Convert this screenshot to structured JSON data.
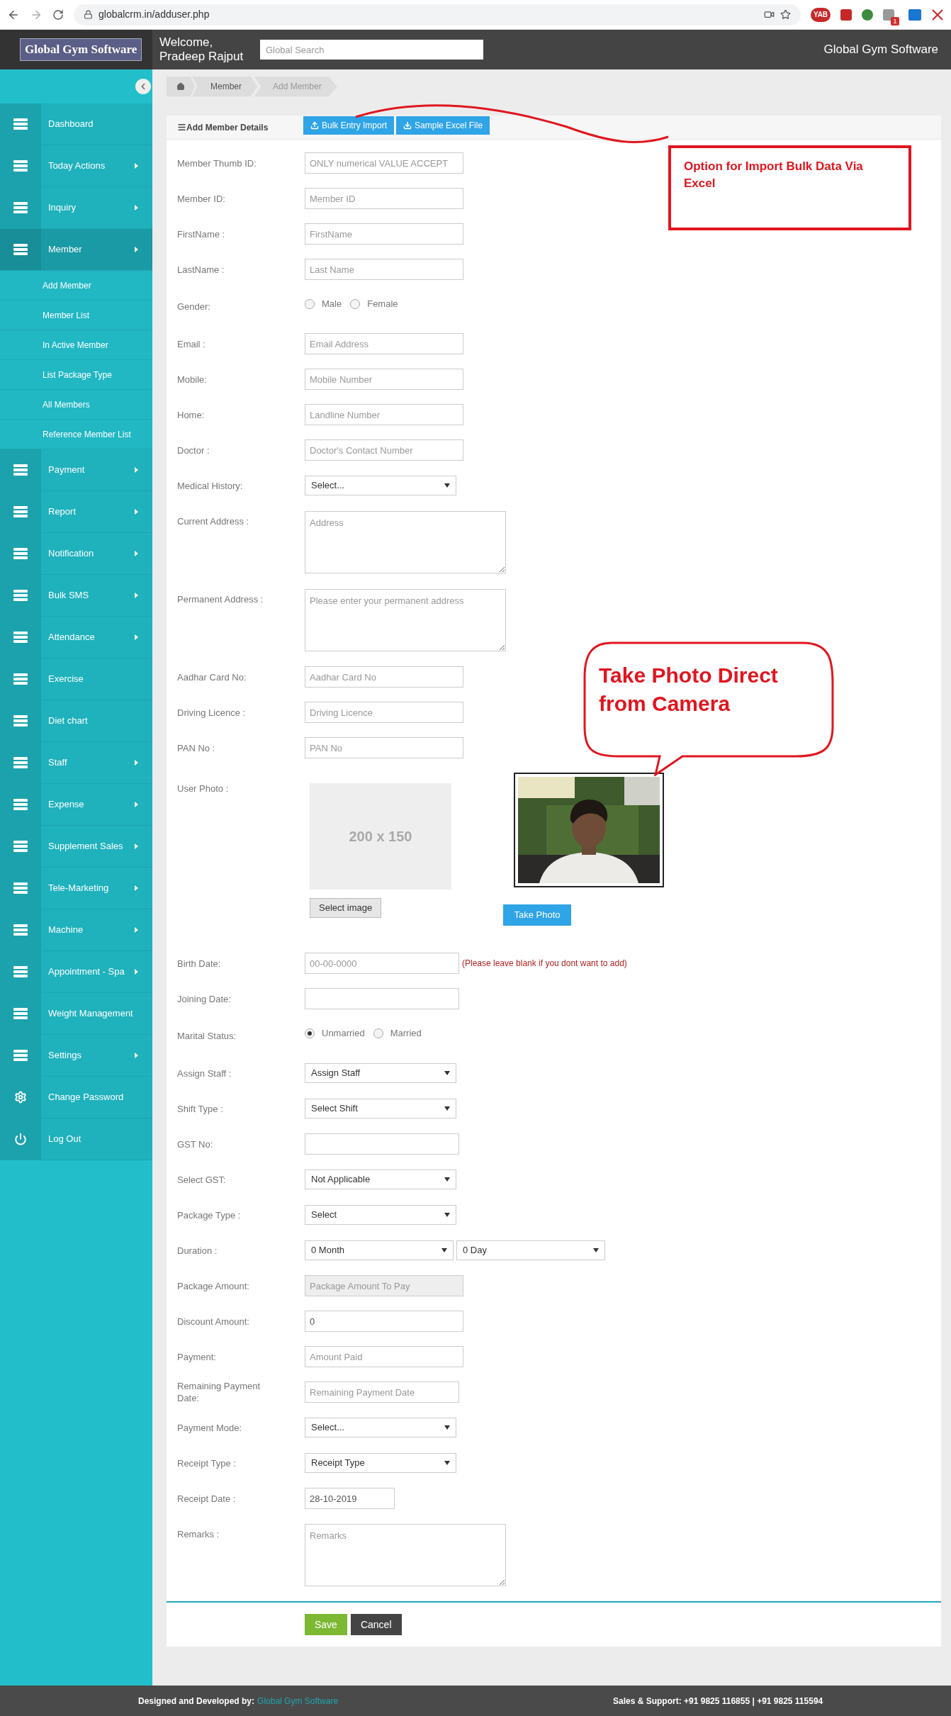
{
  "browser": {
    "url": "globalcrm.in/adduser.php",
    "extension_label": "YAB",
    "notification_count": "1"
  },
  "header": {
    "logo": "Global Gym Software",
    "welcome": "Welcome,",
    "user": "Pradeep Rajput",
    "search_placeholder": "Global Search",
    "brand": "Global Gym Software"
  },
  "sidebar": {
    "items": [
      {
        "label": "Dashboard",
        "kind": "menu",
        "has_submenu": false,
        "selected": false
      },
      {
        "label": "Today Actions",
        "kind": "menu",
        "has_submenu": true,
        "selected": false
      },
      {
        "label": "Inquiry",
        "kind": "menu",
        "has_submenu": true,
        "selected": false
      },
      {
        "label": "Member",
        "kind": "menu",
        "has_submenu": true,
        "selected": true,
        "children": [
          {
            "label": "Add Member"
          },
          {
            "label": "Member List"
          },
          {
            "label": "In Active Member"
          },
          {
            "label": "List Package Type"
          },
          {
            "label": "All Members"
          },
          {
            "label": "Reference Member List"
          }
        ]
      },
      {
        "label": "Payment",
        "kind": "menu",
        "has_submenu": true,
        "selected": false
      },
      {
        "label": "Report",
        "kind": "menu",
        "has_submenu": true,
        "selected": false
      },
      {
        "label": "Notification",
        "kind": "menu",
        "has_submenu": true,
        "selected": false
      },
      {
        "label": "Bulk SMS",
        "kind": "menu",
        "has_submenu": true,
        "selected": false
      },
      {
        "label": "Attendance",
        "kind": "menu",
        "has_submenu": true,
        "selected": false
      },
      {
        "label": "Exercise",
        "kind": "menu",
        "has_submenu": false,
        "selected": false
      },
      {
        "label": "Diet chart",
        "kind": "menu",
        "has_submenu": false,
        "selected": false
      },
      {
        "label": "Staff",
        "kind": "menu",
        "has_submenu": true,
        "selected": false
      },
      {
        "label": "Expense",
        "kind": "menu",
        "has_submenu": true,
        "selected": false
      },
      {
        "label": "Supplement Sales",
        "kind": "menu",
        "has_submenu": true,
        "selected": false
      },
      {
        "label": "Tele-Marketing",
        "kind": "menu",
        "has_submenu": true,
        "selected": false
      },
      {
        "label": "Machine",
        "kind": "menu",
        "has_submenu": true,
        "selected": false
      },
      {
        "label": "Appointment - Spa",
        "kind": "menu",
        "has_submenu": true,
        "selected": false
      },
      {
        "label": "Weight Management",
        "kind": "menu",
        "has_submenu": false,
        "selected": false
      },
      {
        "label": "Settings",
        "kind": "menu",
        "has_submenu": true,
        "selected": false
      },
      {
        "label": "Change Password",
        "kind": "gear",
        "has_submenu": false,
        "selected": false
      },
      {
        "label": "Log Out",
        "kind": "power",
        "has_submenu": false,
        "selected": false
      }
    ]
  },
  "breadcrumb": [
    {
      "label": "Member",
      "selected": false
    },
    {
      "label": "Add Member",
      "selected": true
    }
  ],
  "card": {
    "title": "Add Member Details",
    "buttons": [
      {
        "label": "Bulk Entry Import",
        "kind": "upload"
      },
      {
        "label": "Sample Excel File",
        "kind": "download"
      }
    ]
  },
  "form": {
    "fields": [
      {
        "kind": "input",
        "label": "Member Thumb ID:",
        "placeholder": "ONLY numerical VALUE ACCEPT",
        "disabled": false
      },
      {
        "kind": "input",
        "label": "Member ID:",
        "placeholder": "Member ID",
        "disabled": false
      },
      {
        "kind": "input",
        "label": "FirstName :",
        "placeholder": "FirstName",
        "disabled": false
      },
      {
        "kind": "input",
        "label": "LastName :",
        "placeholder": "Last Name",
        "disabled": false
      },
      {
        "kind": "radio",
        "label": "Gender:",
        "options": [
          {
            "label": "Male",
            "selected": false
          },
          {
            "label": "Female",
            "selected": false
          }
        ]
      },
      {
        "kind": "input",
        "label": "Email :",
        "placeholder": "Email Address",
        "disabled": false
      },
      {
        "kind": "input",
        "label": "Mobile:",
        "placeholder": "Mobile Number",
        "disabled": false
      },
      {
        "kind": "input",
        "label": "Home:",
        "placeholder": "Landline Number",
        "disabled": false
      },
      {
        "kind": "input",
        "label": "Doctor :",
        "placeholder": "Doctor's Contact Number",
        "disabled": false
      },
      {
        "kind": "select",
        "label": "Medical History:",
        "value": "Select..."
      },
      {
        "kind": "textarea",
        "label": "Current Address :",
        "placeholder": "Address"
      },
      {
        "kind": "textarea",
        "label": "Permanent Address :",
        "placeholder": "Please enter your permanent address"
      },
      {
        "kind": "input",
        "label": "Aadhar Card No:",
        "placeholder": "Aadhar Card No",
        "disabled": false
      },
      {
        "kind": "input",
        "label": "Driving Licence :",
        "placeholder": "Driving Licence",
        "disabled": false
      },
      {
        "kind": "input",
        "label": "PAN No :",
        "placeholder": "PAN No",
        "disabled": false
      },
      {
        "label": "User Photo :",
        "placeholder_text": "200 x 150",
        "select_button": "Select image",
        "take_button": "Take Photo"
      },
      {
        "kind": "date",
        "label": "Birth Date:",
        "placeholder": "00-00-0000",
        "note": "(Please leave blank if you dont want to add)",
        "disabled": false
      },
      {
        "kind": "date",
        "label": "Joining Date:",
        "disabled": false
      },
      {
        "kind": "radio",
        "label": "Marital Status:",
        "options": [
          {
            "label": "Unmarried",
            "selected": true
          },
          {
            "label": "Married",
            "selected": false
          }
        ]
      },
      {
        "kind": "select",
        "label": "Assign Staff :",
        "value": "Assign Staff"
      },
      {
        "kind": "select",
        "label": "Shift Type :",
        "value": "Select Shift"
      },
      {
        "kind": "date",
        "label": "GST No:",
        "disabled": false
      },
      {
        "kind": "select",
        "label": "Select GST:",
        "value": "Not Applicable"
      },
      {
        "kind": "select",
        "label": "Package Type :",
        "value": "Select"
      },
      {
        "kind": "select_pair",
        "label": "Duration :",
        "values": [
          "0 Month",
          "0 Day"
        ]
      },
      {
        "kind": "input",
        "label": "Package Amount:",
        "placeholder": "Package Amount To Pay",
        "disabled": true
      },
      {
        "kind": "input",
        "label": "Discount Amount:",
        "value": "0",
        "disabled": false
      },
      {
        "kind": "input",
        "label": "Payment:",
        "placeholder": "Amount Paid",
        "disabled": false
      },
      {
        "kind": "date",
        "label": "Remaining Payment Date:",
        "placeholder": "Remaining Payment Date",
        "disabled": false
      },
      {
        "kind": "select",
        "label": "Payment Mode:",
        "value": "Select..."
      },
      {
        "kind": "select",
        "label": "Receipt Type :",
        "value": "Receipt Type"
      },
      {
        "kind": "short_input",
        "label": "Receipt Date :",
        "value": "28-10-2019",
        "disabled": false
      },
      {
        "kind": "textarea",
        "label": "Remarks :",
        "placeholder": "Remarks"
      }
    ]
  },
  "actions": [
    {
      "label": "Save",
      "kind": "primary"
    },
    {
      "label": "Cancel",
      "kind": "secondary"
    }
  ],
  "annotations": [
    {
      "kind": "box",
      "text": "Option for Import Bulk Data Via Excel"
    },
    {
      "kind": "bubble",
      "text": "Take Photo Direct from Camera"
    }
  ],
  "footer": {
    "credit_label": "Designed and Developed by:",
    "credit_link": "Global Gym Software",
    "support": "Sales & Support: +91 9825 116855 | +91 9825 115594"
  }
}
